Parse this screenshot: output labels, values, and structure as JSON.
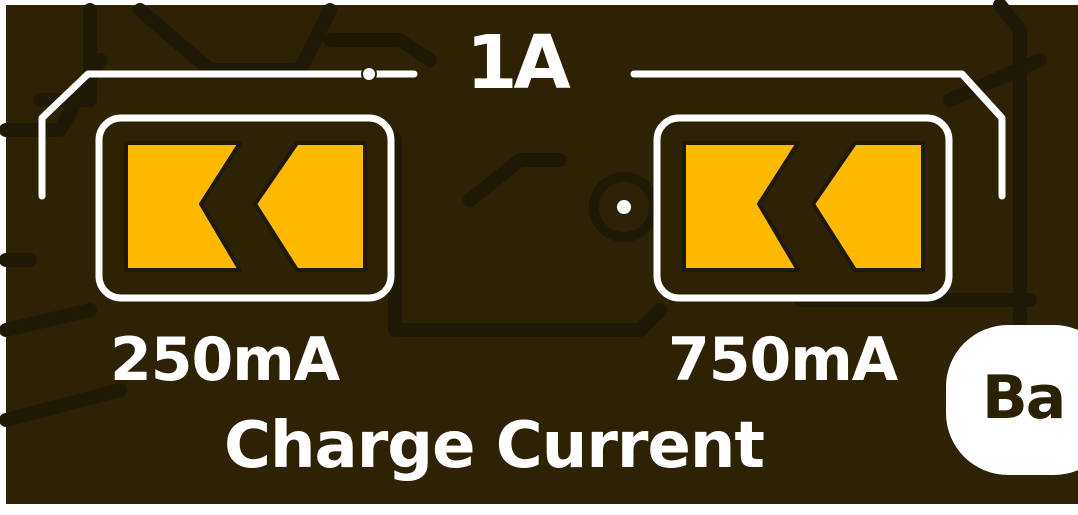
{
  "board": {
    "top_current_label": "1A",
    "left_current_label": "250mA",
    "right_current_label": "750mA",
    "charge_current_caption": "Charge Current",
    "badge_text": "Ba"
  },
  "colors": {
    "board_background": "#2d2204",
    "silkscreen": "#ffffff",
    "pad_gold": "#ffba00",
    "trace_shadow": "#1f1a08"
  },
  "icons": {
    "left_pad": "solder-jumper-pad-icon",
    "right_pad": "solder-jumper-pad-icon",
    "via": "via-icon"
  }
}
